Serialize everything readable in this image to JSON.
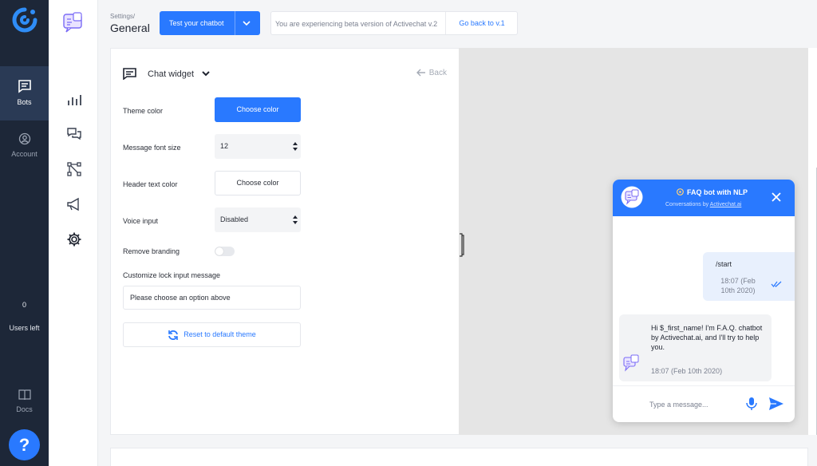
{
  "nav": {
    "items": [
      {
        "label": "Bots",
        "icon": "chat-bubble-icon",
        "active": true
      },
      {
        "label": "Account",
        "icon": "user-circle-icon",
        "active": false
      }
    ],
    "users_left_count": "0",
    "users_left_label": "Users left",
    "docs_label": "Docs",
    "help_label": "?"
  },
  "subnav": {
    "icons": [
      "bot-avatar-icon",
      "analytics-bars-icon",
      "conversations-icon",
      "flow-icon",
      "broadcast-megaphone-icon",
      "settings-gear-icon"
    ]
  },
  "header": {
    "breadcrumb": "Settings/",
    "title": "General",
    "test_button": "Test your chatbot",
    "beta_message": "You are experiencing beta version of Activechat v.2",
    "go_back": "Go back to v.1"
  },
  "panel": {
    "widget_selector": "Chat widget",
    "back_label": "Back",
    "theme_color_label": "Theme color",
    "theme_color_button": "Choose color",
    "font_size_label": "Message font size",
    "font_size_value": "12",
    "header_text_color_label": "Header text color",
    "header_text_color_button": "Choose color",
    "voice_input_label": "Voice input",
    "voice_input_value": "Disabled",
    "remove_branding_label": "Remove branding",
    "remove_branding_enabled": false,
    "lock_message_label": "Customize lock input message",
    "lock_message_value": "Please choose an option above",
    "reset_label": "Reset to default theme"
  },
  "chat": {
    "title": "FAQ bot with NLP",
    "conversations_prefix": "Conversations by",
    "conversations_link": "Activechat.ai",
    "outgoing": {
      "text": "/start",
      "time": "18:07 (Feb 10th 2020)"
    },
    "incoming": {
      "text": "Hi $_first_name! I'm F.A.Q. chatbot by Activechat.ai, and I'll try to help you.",
      "time": "18:07 (Feb 10th 2020)"
    },
    "input_placeholder": "Type a message..."
  },
  "colors": {
    "accent": "#2979ff",
    "nav_bg": "#1d2738",
    "nav_active": "#2a3a55",
    "preview_bg": "#e5e5e5"
  }
}
